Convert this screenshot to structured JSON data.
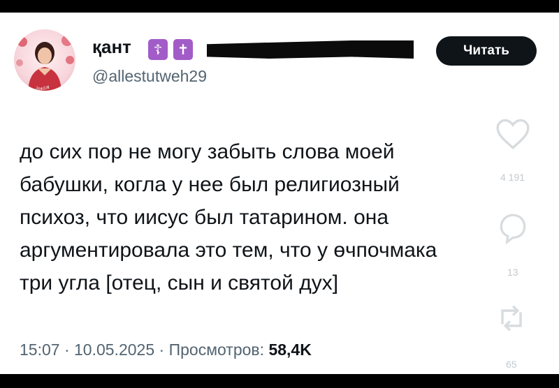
{
  "profile": {
    "display_name": "қант",
    "badges": [
      "☦",
      "✝"
    ],
    "handle": "@allestutweh29",
    "avatar_caption": "Холодная"
  },
  "follow_button": {
    "label": "Читать"
  },
  "tweet": {
    "lines": [
      "до сих пор не могу забыть слова моей",
      "бабушки, когла у нее был религиозный",
      "психоз, что иисус был татарином. она",
      "аргументировала это тем, что у өчпочмака",
      "три угла [отец, сын и святой дух]"
    ]
  },
  "meta": {
    "time": "15:07",
    "separator": " · ",
    "date": "10.05.2025",
    "views_label": "Просмотров:",
    "views_count": "58,4K"
  },
  "background_actions": {
    "likes_count": "4 191",
    "replies_count": "13",
    "reposts_count": "65"
  }
}
